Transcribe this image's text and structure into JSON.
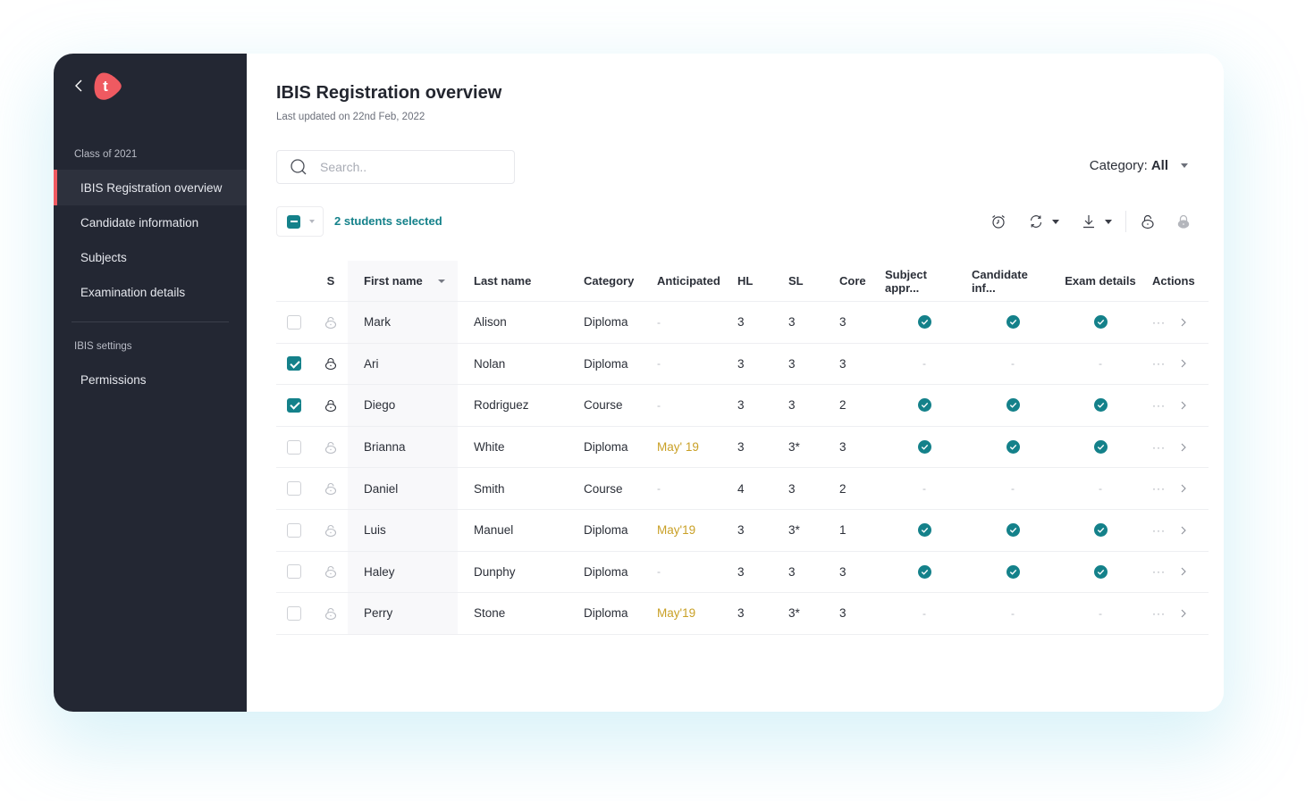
{
  "sidebar": {
    "back_icon": "chevron-left-icon",
    "logo_letter": "t",
    "brand_color": "#ef5a61",
    "sections": [
      {
        "label": "Class of 2021",
        "items": [
          {
            "label": "IBIS Registration overview",
            "active": true
          },
          {
            "label": "Candidate information",
            "active": false
          },
          {
            "label": "Subjects",
            "active": false
          },
          {
            "label": "Examination details",
            "active": false
          }
        ]
      },
      {
        "label": "IBIS settings",
        "items": [
          {
            "label": "Permissions",
            "active": false
          }
        ]
      }
    ]
  },
  "header": {
    "title": "IBIS Registration overview",
    "subtitle": "Last updated on 22nd Feb, 2022"
  },
  "search": {
    "placeholder": "Search..",
    "value": ""
  },
  "filter": {
    "label": "Category:",
    "value": "All"
  },
  "selection": {
    "count_label": "2 students selected"
  },
  "toolbar": {
    "icons": [
      "alarm-clock-icon",
      "refresh-icon",
      "download-icon",
      "unlock-icon",
      "lock-icon"
    ]
  },
  "accent_color": "#14818a",
  "table": {
    "columns": [
      "S",
      "First name",
      "Last name",
      "Category",
      "Anticipated",
      "HL",
      "SL",
      "Core",
      "Subject appr...",
      "Candidate inf...",
      "Exam details",
      "Actions"
    ],
    "rows": [
      {
        "selected": false,
        "locked": false,
        "first": "Mark",
        "last": "Alison",
        "category": "Diploma",
        "anticipated": "-",
        "hl": "3",
        "sl": "3",
        "core": "3",
        "subject_approved": true,
        "candidate_info": true,
        "exam_details": true
      },
      {
        "selected": true,
        "locked": true,
        "first": "Ari",
        "last": "Nolan",
        "category": "Diploma",
        "anticipated": "-",
        "hl": "3",
        "sl": "3",
        "core": "3",
        "subject_approved": false,
        "candidate_info": false,
        "exam_details": false
      },
      {
        "selected": true,
        "locked": true,
        "first": "Diego",
        "last": "Rodriguez",
        "category": "Course",
        "anticipated": "-",
        "hl": "3",
        "sl": "3",
        "core": "2",
        "subject_approved": true,
        "candidate_info": true,
        "exam_details": true
      },
      {
        "selected": false,
        "locked": false,
        "first": "Brianna",
        "last": "White",
        "category": "Diploma",
        "anticipated": "May' 19",
        "hl": "3",
        "sl": "3*",
        "core": "3",
        "subject_approved": true,
        "candidate_info": true,
        "exam_details": true
      },
      {
        "selected": false,
        "locked": false,
        "first": "Daniel",
        "last": "Smith",
        "category": "Course",
        "anticipated": "-",
        "hl": "4",
        "sl": "3",
        "core": "2",
        "subject_approved": false,
        "candidate_info": false,
        "exam_details": false
      },
      {
        "selected": false,
        "locked": false,
        "first": "Luis",
        "last": "Manuel",
        "category": "Diploma",
        "anticipated": "May'19",
        "hl": "3",
        "sl": "3*",
        "core": "1",
        "subject_approved": true,
        "candidate_info": true,
        "exam_details": true
      },
      {
        "selected": false,
        "locked": false,
        "first": "Haley",
        "last": "Dunphy",
        "category": "Diploma",
        "anticipated": "-",
        "hl": "3",
        "sl": "3",
        "core": "3",
        "subject_approved": true,
        "candidate_info": true,
        "exam_details": true
      },
      {
        "selected": false,
        "locked": false,
        "first": "Perry",
        "last": "Stone",
        "category": "Diploma",
        "anticipated": "May'19",
        "hl": "3",
        "sl": "3*",
        "core": "3",
        "subject_approved": false,
        "candidate_info": false,
        "exam_details": false
      }
    ],
    "empty_value": "-",
    "more_label": "···"
  }
}
